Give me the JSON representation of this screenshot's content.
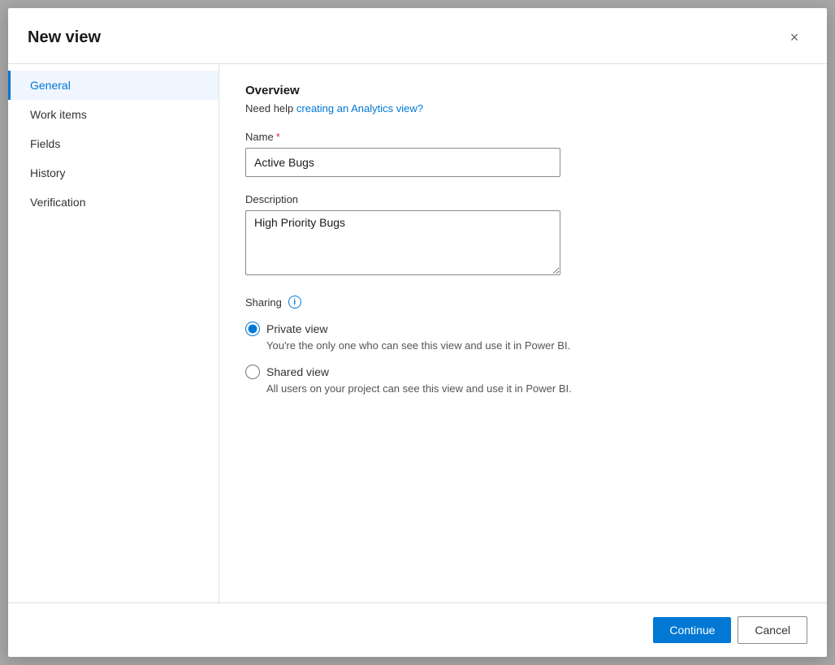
{
  "dialog": {
    "title": "New view",
    "close_label": "×"
  },
  "sidebar": {
    "items": [
      {
        "id": "general",
        "label": "General",
        "active": true
      },
      {
        "id": "work-items",
        "label": "Work items",
        "active": false
      },
      {
        "id": "fields",
        "label": "Fields",
        "active": false
      },
      {
        "id": "history",
        "label": "History",
        "active": false
      },
      {
        "id": "verification",
        "label": "Verification",
        "active": false
      }
    ]
  },
  "main": {
    "overview_title": "Overview",
    "help_prefix": "Need help ",
    "help_link_text": "creating an Analytics view?",
    "name_label": "Name",
    "name_value": "Active Bugs",
    "description_label": "Description",
    "description_value": "High Priority Bugs",
    "sharing_label": "Sharing",
    "sharing_info_icon": "i",
    "radio_private_label": "Private view",
    "radio_private_description": "You're the only one who can see this view and use it in Power BI.",
    "radio_shared_label": "Shared view",
    "radio_shared_description": "All users on your project can see this view and use it in Power BI."
  },
  "footer": {
    "continue_label": "Continue",
    "cancel_label": "Cancel"
  },
  "colors": {
    "accent": "#0078d4",
    "required": "#d13438"
  }
}
